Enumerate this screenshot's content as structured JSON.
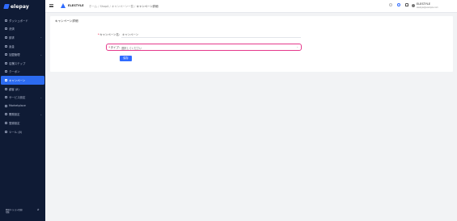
{
  "app": {
    "logo_text": "elepay"
  },
  "sidebar": {
    "items": [
      {
        "label": "ダッシュボード",
        "icon": "dashboard-icon",
        "chevron": false
      },
      {
        "label": "決済",
        "icon": "payment-icon",
        "chevron": false
      },
      {
        "label": "請求",
        "icon": "invoice-icon",
        "chevron": true
      },
      {
        "label": "返金",
        "icon": "refund-icon",
        "chevron": false
      },
      {
        "label": "加盟管理",
        "icon": "store-icon",
        "chevron": true
      },
      {
        "label": "店舗ステップ",
        "icon": "steps-icon",
        "chevron": false
      },
      {
        "label": "クーポン",
        "icon": "coupon-icon",
        "chevron": false
      },
      {
        "label": "キャンペーン",
        "icon": "campaign-icon",
        "chevron": false,
        "active": true
      },
      {
        "label": "顧客 (β)",
        "icon": "customer-icon",
        "chevron": false
      },
      {
        "label": "サービス設定",
        "icon": "settings-icon",
        "chevron": true
      },
      {
        "label": "Marketplace",
        "icon": "marketplace-icon",
        "chevron": false
      },
      {
        "label": "開発設定",
        "icon": "developer-icon",
        "chevron": true
      },
      {
        "label": "登録設定",
        "icon": "registration-icon",
        "chevron": false
      },
      {
        "label": "ツール (β)",
        "icon": "tool-icon",
        "chevron": false
      }
    ],
    "footer": {
      "line1": "開発中 (テスト環境)",
      "line2": "切替"
    }
  },
  "header": {
    "brand": "ELESTYLE",
    "breadcrumb": [
      "ホーム",
      "ShopA",
      "キャンペーン一覧",
      "キャンペーン詳細"
    ],
    "account_name": "ELESTYLE",
    "account_email": "elestyle@example.com"
  },
  "main": {
    "card_title": "キャンペーン詳細",
    "form": {
      "name_label": "キャンペーン名",
      "name_value": "キャンペーン",
      "type_label": "タイプ",
      "type_placeholder": "選択してください",
      "save_label": "保存"
    }
  },
  "colors": {
    "sidebar_bg": "#0f1b35",
    "accent": "#2f6bff",
    "focus_ring": "#e5398c"
  }
}
